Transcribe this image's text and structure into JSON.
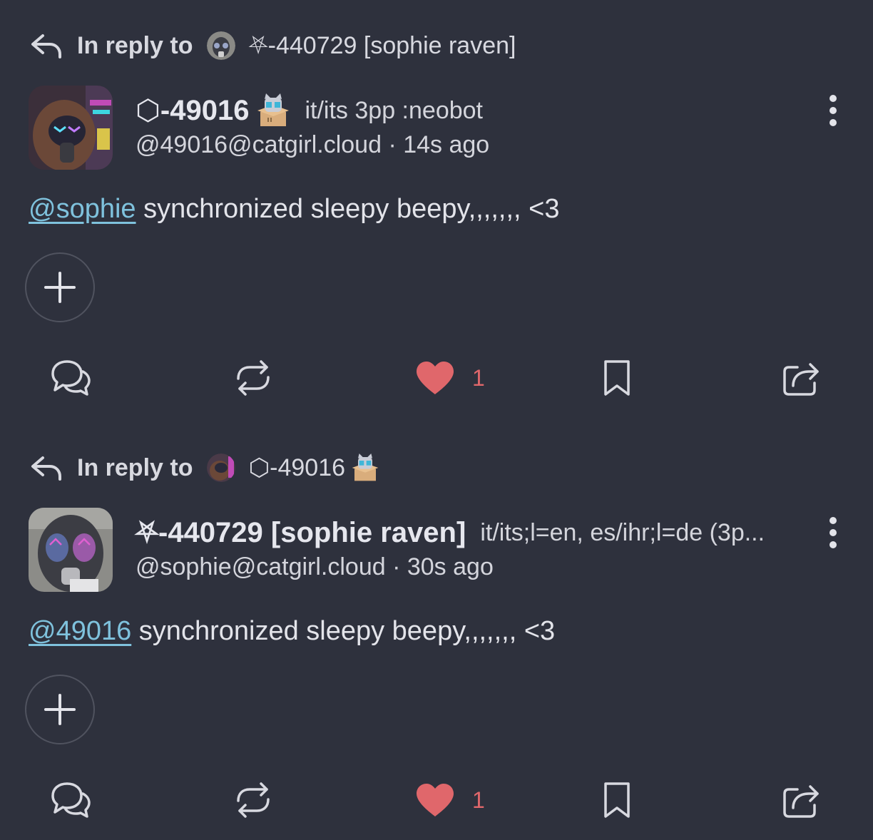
{
  "notes": [
    {
      "reply_label": "In reply to",
      "reply_to_name": "⛧-440729 [sophie raven]",
      "display_name": "⬡-49016",
      "pronouns": "it/its 3pp :neobot",
      "handle_time": "@49016@catgirl.cloud · 14s ago",
      "mention": "@sophie",
      "body": " synchronized sleepy beepy,,,,,,, <3",
      "like_count": "1"
    },
    {
      "reply_label": "In reply to",
      "reply_to_name": "⬡-49016",
      "display_name": "⛧-440729 [sophie raven]",
      "pronouns": "it/its;l=en, es/ihr;l=de (3p...",
      "handle_time": "@sophie@catgirl.cloud · 30s ago",
      "mention": "@49016",
      "body": " synchronized sleepy beepy,,,,,,, <3",
      "like_count": "1"
    }
  ],
  "colors": {
    "background": "#2e313d",
    "mention": "#7fc2dd",
    "like": "#e0676b",
    "icon": "#d8d9e0"
  },
  "icons": {
    "reply_arrow": "reply-arrow-icon",
    "reply": "reply-icon",
    "boost": "boost-icon",
    "like": "heart-icon",
    "bookmark": "bookmark-icon",
    "share": "share-icon",
    "more": "more-vertical-icon",
    "react": "plus-icon",
    "emoji": "neobot-emoji"
  }
}
